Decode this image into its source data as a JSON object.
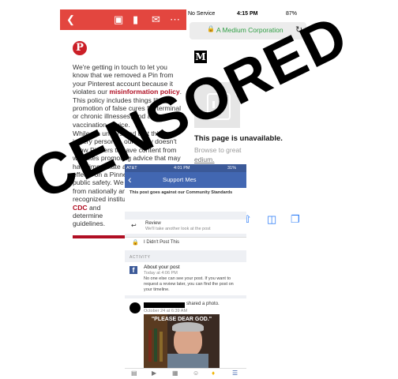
{
  "email": {
    "text_1": [
      "We're getting in touch to let you",
      "know that we removed a Pin from",
      "your Pinterest account because it",
      "violates our"
    ],
    "policy_link": "misinformation policy",
    "text_2": [
      "This policy includes things like",
      "promotion of false cures for terminal",
      "or chronic illnesses, and anti-",
      "vaccination advice."
    ],
    "text_3": [
      "While we understand that this topic",
      "is very personal, our policy doesn't",
      "allow Pinners to save content from",
      "websites promoting advice that may",
      "have immediate and detrimental",
      "effects on a Pinner",
      "public safety. We re",
      "from nationally and",
      "recognized institutio"
    ],
    "cdc": "CDC",
    "and": "and",
    "text_4": [
      "determine",
      "guidelines."
    ]
  },
  "safari": {
    "carrier": "No Service",
    "time": "4:15 PM",
    "battery": "87%",
    "url": "A Medium Corporation",
    "medium_logo": "M",
    "page_title": "This page is unavailable.",
    "page_sub_1": "Browse to great",
    "page_sub_2": "edium."
  },
  "facebook": {
    "carrier": "AT&T",
    "time": "4:01 PM",
    "battery": "31%",
    "nav_title": "Support Mes",
    "notice": "This post goes against our Community Standards",
    "review_label": "Review",
    "review_sub": "We'll take another look at the post",
    "didnt_post": "I Didn't Post This",
    "activity": "ACTIVITY",
    "about_title": "About your post",
    "about_time": "Today at 4:06 PM",
    "about_text": [
      "No one else can see your post. If you want to",
      "request a review later, you can find the post on",
      "your timeline."
    ],
    "shared": "shared a photo.",
    "shared_time": "October 24 at 6:39 AM",
    "meme_caption": "\"PLEASE DEAR GOD.\""
  },
  "stamp": {
    "text": "CENSORED"
  }
}
